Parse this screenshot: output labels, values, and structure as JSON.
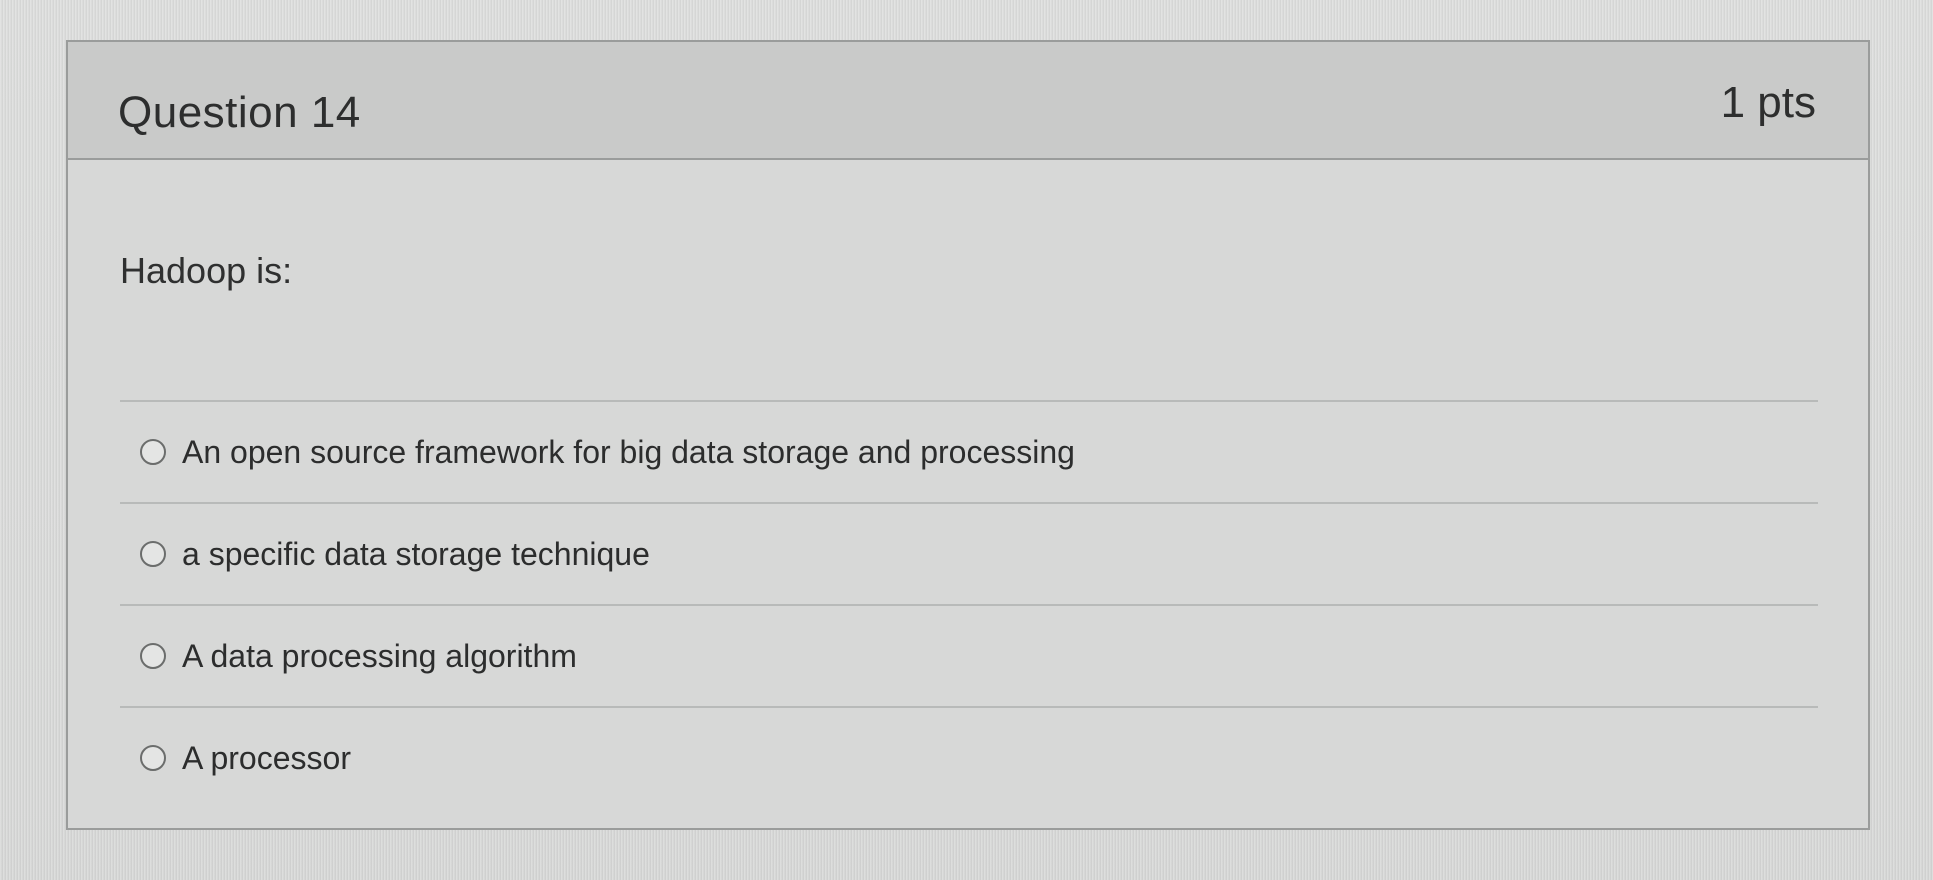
{
  "question": {
    "title": "Question 14",
    "points": "1 pts",
    "prompt": "Hadoop is:"
  },
  "answers": [
    {
      "label": "An open source framework for big data storage and processing",
      "selected": false
    },
    {
      "label": "a specific data storage technique",
      "selected": false
    },
    {
      "label": "A data processing algorithm",
      "selected": false
    },
    {
      "label": "A processor",
      "selected": false
    }
  ],
  "colors": {
    "background": "#d9dad9",
    "header": "#c9cac9",
    "border": "#9a9c9b",
    "text": "#2d2e2e"
  }
}
